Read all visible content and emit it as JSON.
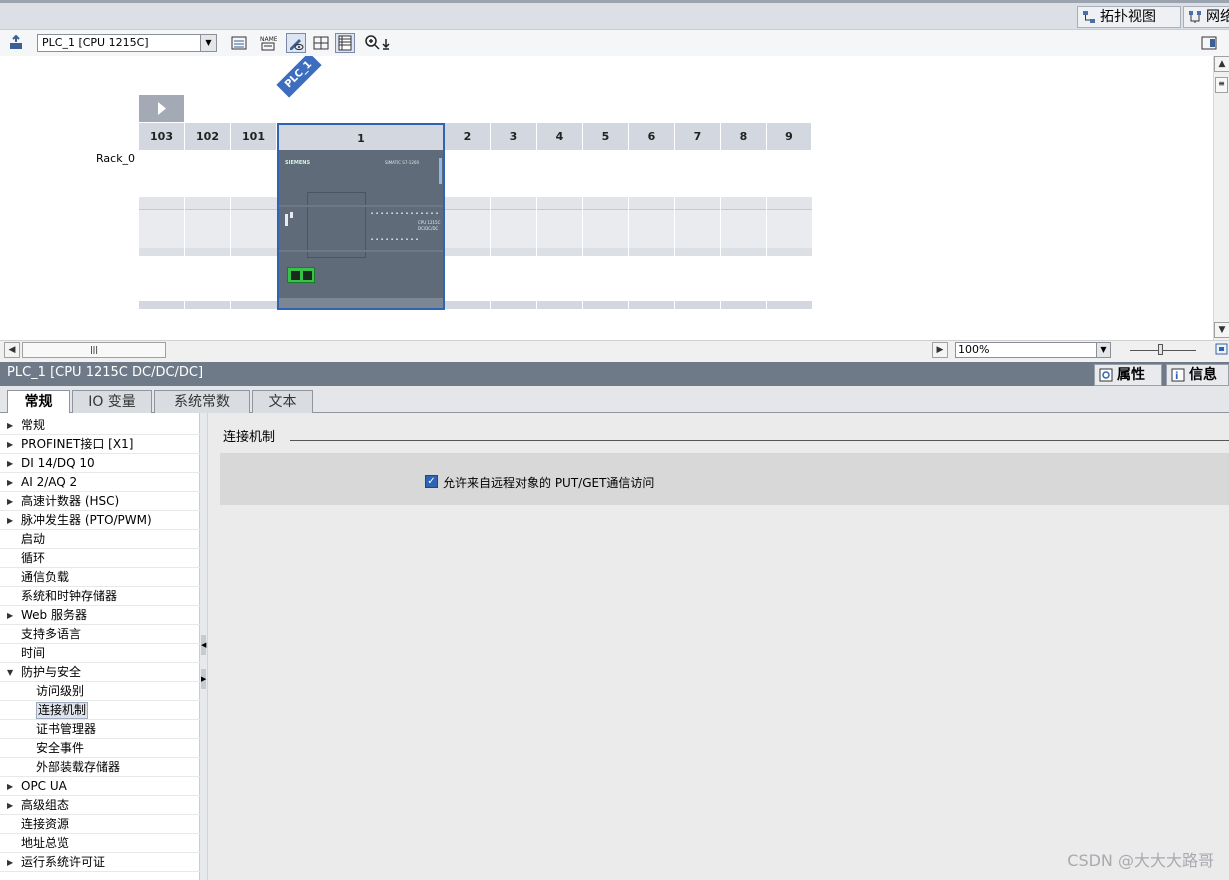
{
  "topbar": {
    "topology_view": "拓扑视图",
    "network_view": "网络"
  },
  "toolbar": {
    "device_select": "PLC_1 [CPU 1215C]"
  },
  "canvas": {
    "device_tag": "PLC_1",
    "rack_label": "Rack_0",
    "slots": [
      "103",
      "102",
      "101",
      "1",
      "2",
      "3",
      "4",
      "5",
      "6",
      "7",
      "8",
      "9"
    ],
    "cpu_brand": "SIEMENS",
    "cpu_series": "SIMATIC S7-1200",
    "cpu_model": "CPU 1215C",
    "cpu_variant": "DC/DC/DC"
  },
  "hbar": {
    "zoom": "100%"
  },
  "properties": {
    "title": "PLC_1 [CPU 1215C DC/DC/DC]",
    "tab_properties": "属性",
    "tab_info": "信息",
    "subtabs": [
      "常规",
      "IO 变量",
      "系统常数",
      "文本"
    ]
  },
  "tree": {
    "items": [
      {
        "label": "常规",
        "caret": "right"
      },
      {
        "label": "PROFINET接口 [X1]",
        "caret": "right"
      },
      {
        "label": "DI 14/DQ 10",
        "caret": "right"
      },
      {
        "label": "AI 2/AQ 2",
        "caret": "right"
      },
      {
        "label": "高速计数器 (HSC)",
        "caret": "right"
      },
      {
        "label": "脉冲发生器 (PTO/PWM)",
        "caret": "right"
      },
      {
        "label": "启动",
        "caret": ""
      },
      {
        "label": "循环",
        "caret": ""
      },
      {
        "label": "通信负载",
        "caret": ""
      },
      {
        "label": "系统和时钟存储器",
        "caret": ""
      },
      {
        "label": "Web 服务器",
        "caret": "right"
      },
      {
        "label": "支持多语言",
        "caret": ""
      },
      {
        "label": "时间",
        "caret": ""
      },
      {
        "label": "防护与安全",
        "caret": "down"
      },
      {
        "label": "访问级别",
        "caret": "",
        "indent": 1
      },
      {
        "label": "连接机制",
        "caret": "",
        "indent": 1,
        "selected": true
      },
      {
        "label": "证书管理器",
        "caret": "",
        "indent": 1
      },
      {
        "label": "安全事件",
        "caret": "",
        "indent": 1
      },
      {
        "label": "外部装载存储器",
        "caret": "",
        "indent": 1
      },
      {
        "label": "OPC UA",
        "caret": "right"
      },
      {
        "label": "高级组态",
        "caret": "right"
      },
      {
        "label": "连接资源",
        "caret": ""
      },
      {
        "label": "地址总览",
        "caret": ""
      },
      {
        "label": "运行系统许可证",
        "caret": "right"
      }
    ]
  },
  "content": {
    "section_title": "连接机制",
    "checkbox_label": "允许来自远程对象的 PUT/GET通信访问",
    "checkbox_checked": true
  },
  "watermark": "CSDN @大大大路哥",
  "colors": {
    "accent": "#2f64b4",
    "panel_title": "#6f7a89",
    "cpu_body": "#5f6b78",
    "port_green": "#38c24a"
  }
}
